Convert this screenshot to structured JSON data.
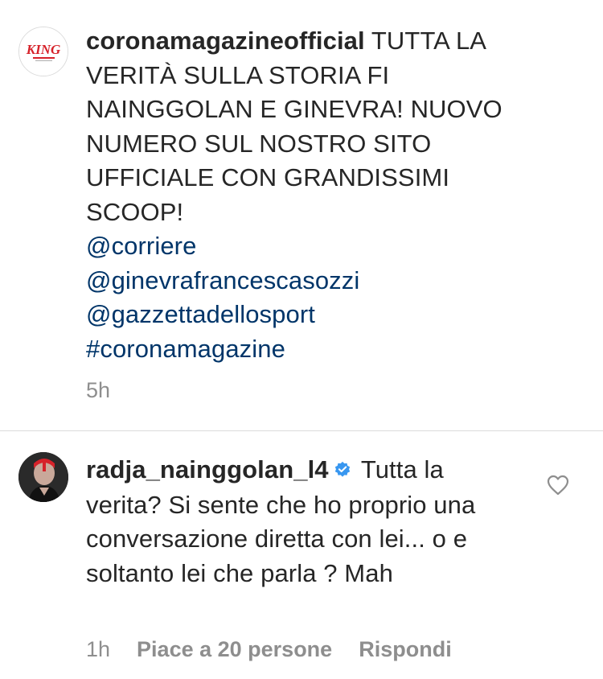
{
  "post": {
    "username": "coronamagazineofficial",
    "avatar_text": "KING",
    "text": "TUTTA LA VERITÀ SULLA STORIA FI NAINGGOLAN E GINEVRA! NUOVO NUMERO SUL NOSTRO SITO UFFICIALE CON GRANDISSIMI SCOOP!",
    "mentions": [
      "@corriere",
      "@ginevrafrancescasozzi",
      "@gazzettadellosport"
    ],
    "hashtag": "#coronamagazine",
    "time": "5h"
  },
  "comment": {
    "username": "radja_nainggolan_l4",
    "verified_icon": "verified-badge-icon",
    "text": "Tutta la verita? Si sente che ho proprio una conversazione diretta con lei... o e soltanto lei che parla ? Mah",
    "time": "1h",
    "likes_label": "Piace a 20 persone",
    "reply_label": "Rispondi",
    "like_icon": "heart-outline-icon"
  },
  "colors": {
    "text": "#262626",
    "link": "#003569",
    "meta": "#8e8e8e",
    "verified": "#3897f0",
    "divider": "#dbdbdb",
    "brand_red": "#d6222a"
  }
}
